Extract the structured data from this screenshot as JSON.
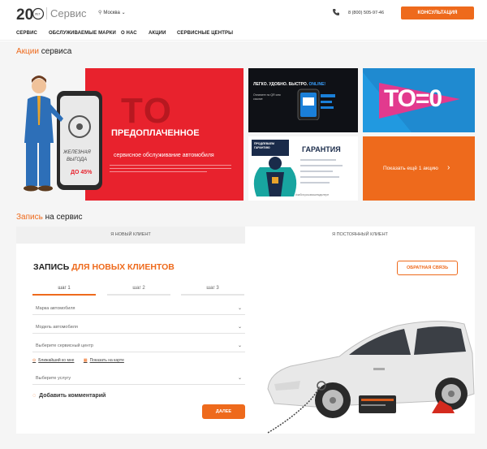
{
  "header": {
    "logo_number": "20",
    "logo_small": "ЛЕТ",
    "brand_label": "Сервис",
    "city": "Москва",
    "phone": "8 (800) 505-97-46",
    "consult_label": "КОНСУЛЬТАЦИЯ",
    "accent_color": "#ee6a1c"
  },
  "nav": {
    "items": [
      "СЕРВИС",
      "ОБСЛУЖИВАЕМЫЕ МАРКИ",
      "О НАС",
      "АКЦИИ",
      "СЕРВИСНЫЕ ЦЕНТРЫ"
    ]
  },
  "promos": {
    "title_accent": "Акции",
    "title_rest": "сервиса",
    "main": {
      "big": "ТО",
      "headline": "ПРЕДОПЛАЧЕННОЕ",
      "subline": "сервисное обслуживание автомобиля",
      "phone_screen_a": "ЖЕЛЕЗНАЯ",
      "phone_screen_b": "ВЫГОДА",
      "phone_screen_c": "ДО 45%"
    },
    "online": {
      "head_a": "ЛЕГКО. УДОБНО. БЫСТРО.",
      "head_b": "ONLINE!",
      "sub": "Оплатите по QR или ссылке"
    },
    "tozero": {
      "text": "ТО=0"
    },
    "guarantee": {
      "title": "ГАРАНТИЯ",
      "badge": "ПРОДЛЕВАЕМ ГАРАНТИЮ",
      "footer": "#забочусьовашемдилере"
    },
    "more": {
      "label": "Показать ещё 1 акцию",
      "arrow": "›"
    }
  },
  "booking": {
    "title_accent": "Запись",
    "title_rest": "на сервис",
    "tabs": [
      "Я НОВЫЙ КЛИЕНТ",
      "Я ПОСТОЯННЫЙ КЛИЕНТ"
    ],
    "form_title_a": "ЗАПИСЬ",
    "form_title_b": "ДЛЯ НОВЫХ КЛИЕНТОВ",
    "feedback_label": "ОБРАТНАЯ СВЯЗЬ",
    "steps": [
      "шаг 1",
      "шаг 2",
      "шаг 3"
    ],
    "active_step": 1,
    "selects": [
      "Марка автомобиля",
      "Модель автомобиля",
      "Выберите сервисный центр",
      "Выберите услугу"
    ],
    "link_nearest": "Ближайший ко мне",
    "link_map": "Показать на карте",
    "comment_label": "Добавить комментарий",
    "submit_label": "ДАЛЕЕ"
  }
}
